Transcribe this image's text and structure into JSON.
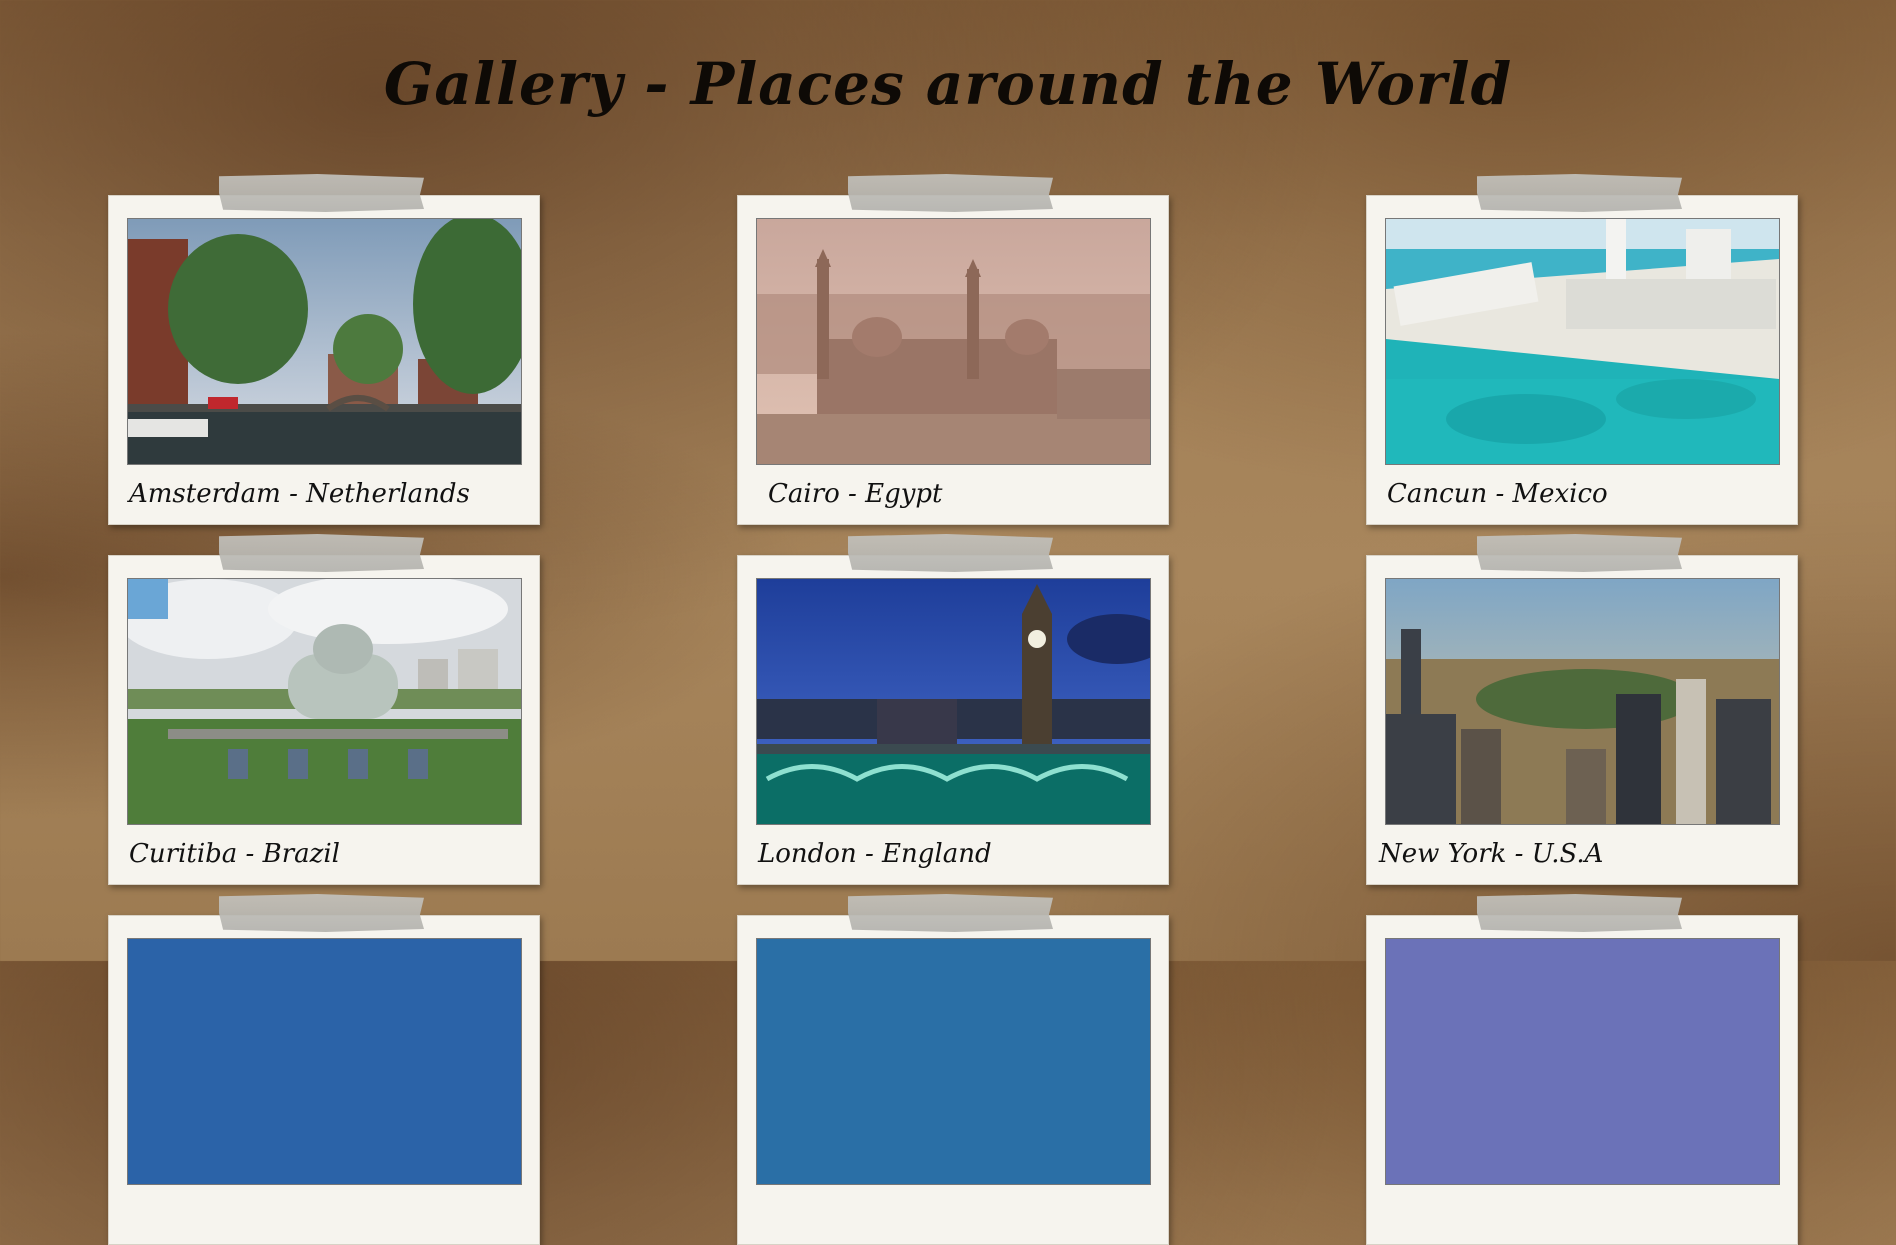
{
  "page": {
    "title": "Gallery - Places around the World"
  },
  "gallery": {
    "items": [
      {
        "caption": "Amsterdam - Netherlands",
        "photo": "amsterdam-canal-photo"
      },
      {
        "caption": "Cairo - Egypt",
        "photo": "cairo-mosque-photo"
      },
      {
        "caption": "Cancun - Mexico",
        "photo": "cancun-beach-photo"
      },
      {
        "caption": "Curitiba - Brazil",
        "photo": "curitiba-botanical-garden-photo"
      },
      {
        "caption": "London - England",
        "photo": "london-big-ben-photo"
      },
      {
        "caption": "New York - U.S.A",
        "photo": "new-york-skyline-photo"
      }
    ]
  }
}
